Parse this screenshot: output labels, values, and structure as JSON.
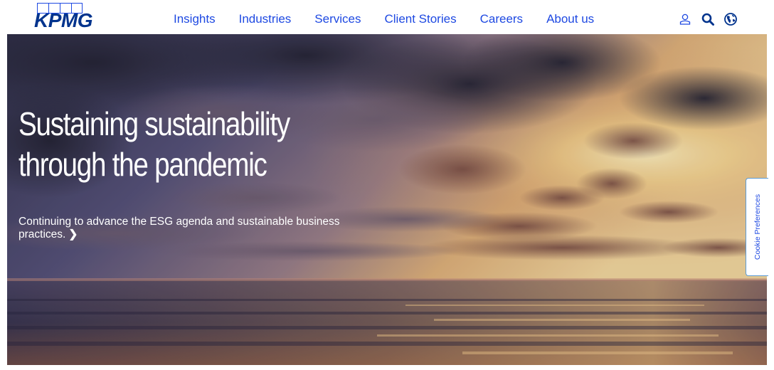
{
  "brand": {
    "logo_text": "KPMG",
    "color": "#00338d",
    "accent": "#1e49e2"
  },
  "nav": {
    "items": [
      {
        "label": "Insights"
      },
      {
        "label": "Industries"
      },
      {
        "label": "Services"
      },
      {
        "label": "Client Stories"
      },
      {
        "label": "Careers"
      },
      {
        "label": "About us"
      }
    ],
    "icons": [
      "user-icon",
      "search-icon",
      "globe-icon"
    ]
  },
  "hero": {
    "title": "Sustaining sustainability through the pandemic",
    "subtitle": "Continuing to advance the ESG agenda and sustainable business practices.",
    "chevron": "❯",
    "image": "sunset-sea-clouds"
  },
  "cookie_tab": {
    "label": "Cookie Preferences"
  }
}
